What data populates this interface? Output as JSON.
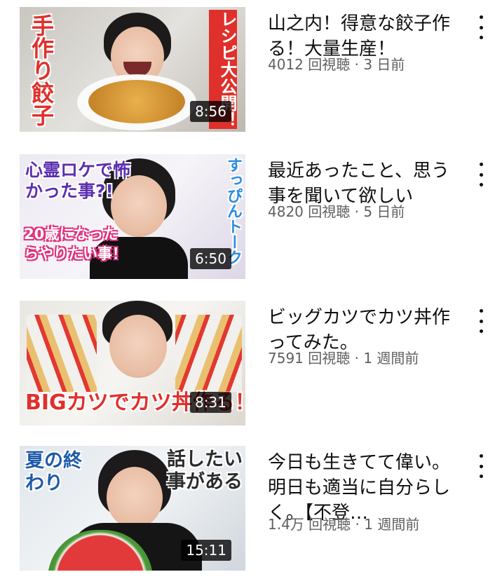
{
  "videos": [
    {
      "title": "山之内！得意な餃子作る！大量生産！",
      "meta": "4012 回視聴 · 3 日前",
      "duration": "8:56",
      "thumb_text_left": "手作り餃子",
      "thumb_text_right": "レシピ大公開！",
      "more_icon": "more-vert-icon"
    },
    {
      "title": "最近あったこと、思う事を聞いて欲しい",
      "meta": "4820 回視聴 · 5 日前",
      "duration": "6:50",
      "thumb_text_left": "心霊ロケで怖かった事?!",
      "thumb_text_right": "すっぴんトーク",
      "thumb_text_bottom": "20歳になったらやりたい事！",
      "more_icon": "more-vert-icon"
    },
    {
      "title": "ビッグカツでカツ丼作ってみた。",
      "meta": "7591 回視聴 · 1 週間前",
      "duration": "8:31",
      "thumb_text_bottom": "BIGカツでカツ丼作る！",
      "more_icon": "more-vert-icon"
    },
    {
      "title": "今日も生きてて偉い。明日も適当に自分らしく。【不登…",
      "meta": "1.4万 回視聴 · 1 週間前",
      "duration": "15:11",
      "thumb_text_left": "夏の終わり",
      "thumb_text_right": "話したい事がある",
      "more_icon": "more-vert-icon"
    }
  ],
  "colors": {
    "text_primary": "#0f0f0f",
    "text_secondary": "#606060",
    "duration_bg": "#000000"
  }
}
